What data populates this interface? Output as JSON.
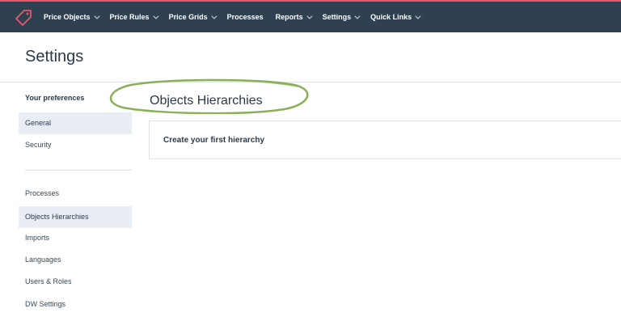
{
  "nav": {
    "items": [
      {
        "label": "Price Objects",
        "has_dropdown": true
      },
      {
        "label": "Price Rules",
        "has_dropdown": true
      },
      {
        "label": "Price Grids",
        "has_dropdown": true
      },
      {
        "label": "Processes",
        "has_dropdown": false
      },
      {
        "label": "Reports",
        "has_dropdown": true
      },
      {
        "label": "Settings",
        "has_dropdown": true
      },
      {
        "label": "Quick Links",
        "has_dropdown": true
      }
    ]
  },
  "page": {
    "title": "Settings"
  },
  "sidebar": {
    "heading": "Your preferences",
    "items": [
      {
        "label": "General"
      },
      {
        "label": "Security"
      },
      {
        "label": "Processes"
      },
      {
        "label": "Objects Hierarchies"
      },
      {
        "label": "Imports"
      },
      {
        "label": "Languages"
      },
      {
        "label": "Users & Roles"
      },
      {
        "label": "DW Settings"
      }
    ]
  },
  "main": {
    "section_title": "Objects Hierarchies",
    "card_text": "Create your first hierarchy"
  },
  "colors": {
    "topbar": "#2f4150",
    "accent": "#e8566b",
    "active_item": "#e9eef4",
    "highlight_ring": "#8ab05a"
  },
  "icons": {
    "logo": "price-tag-icon",
    "dropdown": "chevron-down-icon"
  }
}
